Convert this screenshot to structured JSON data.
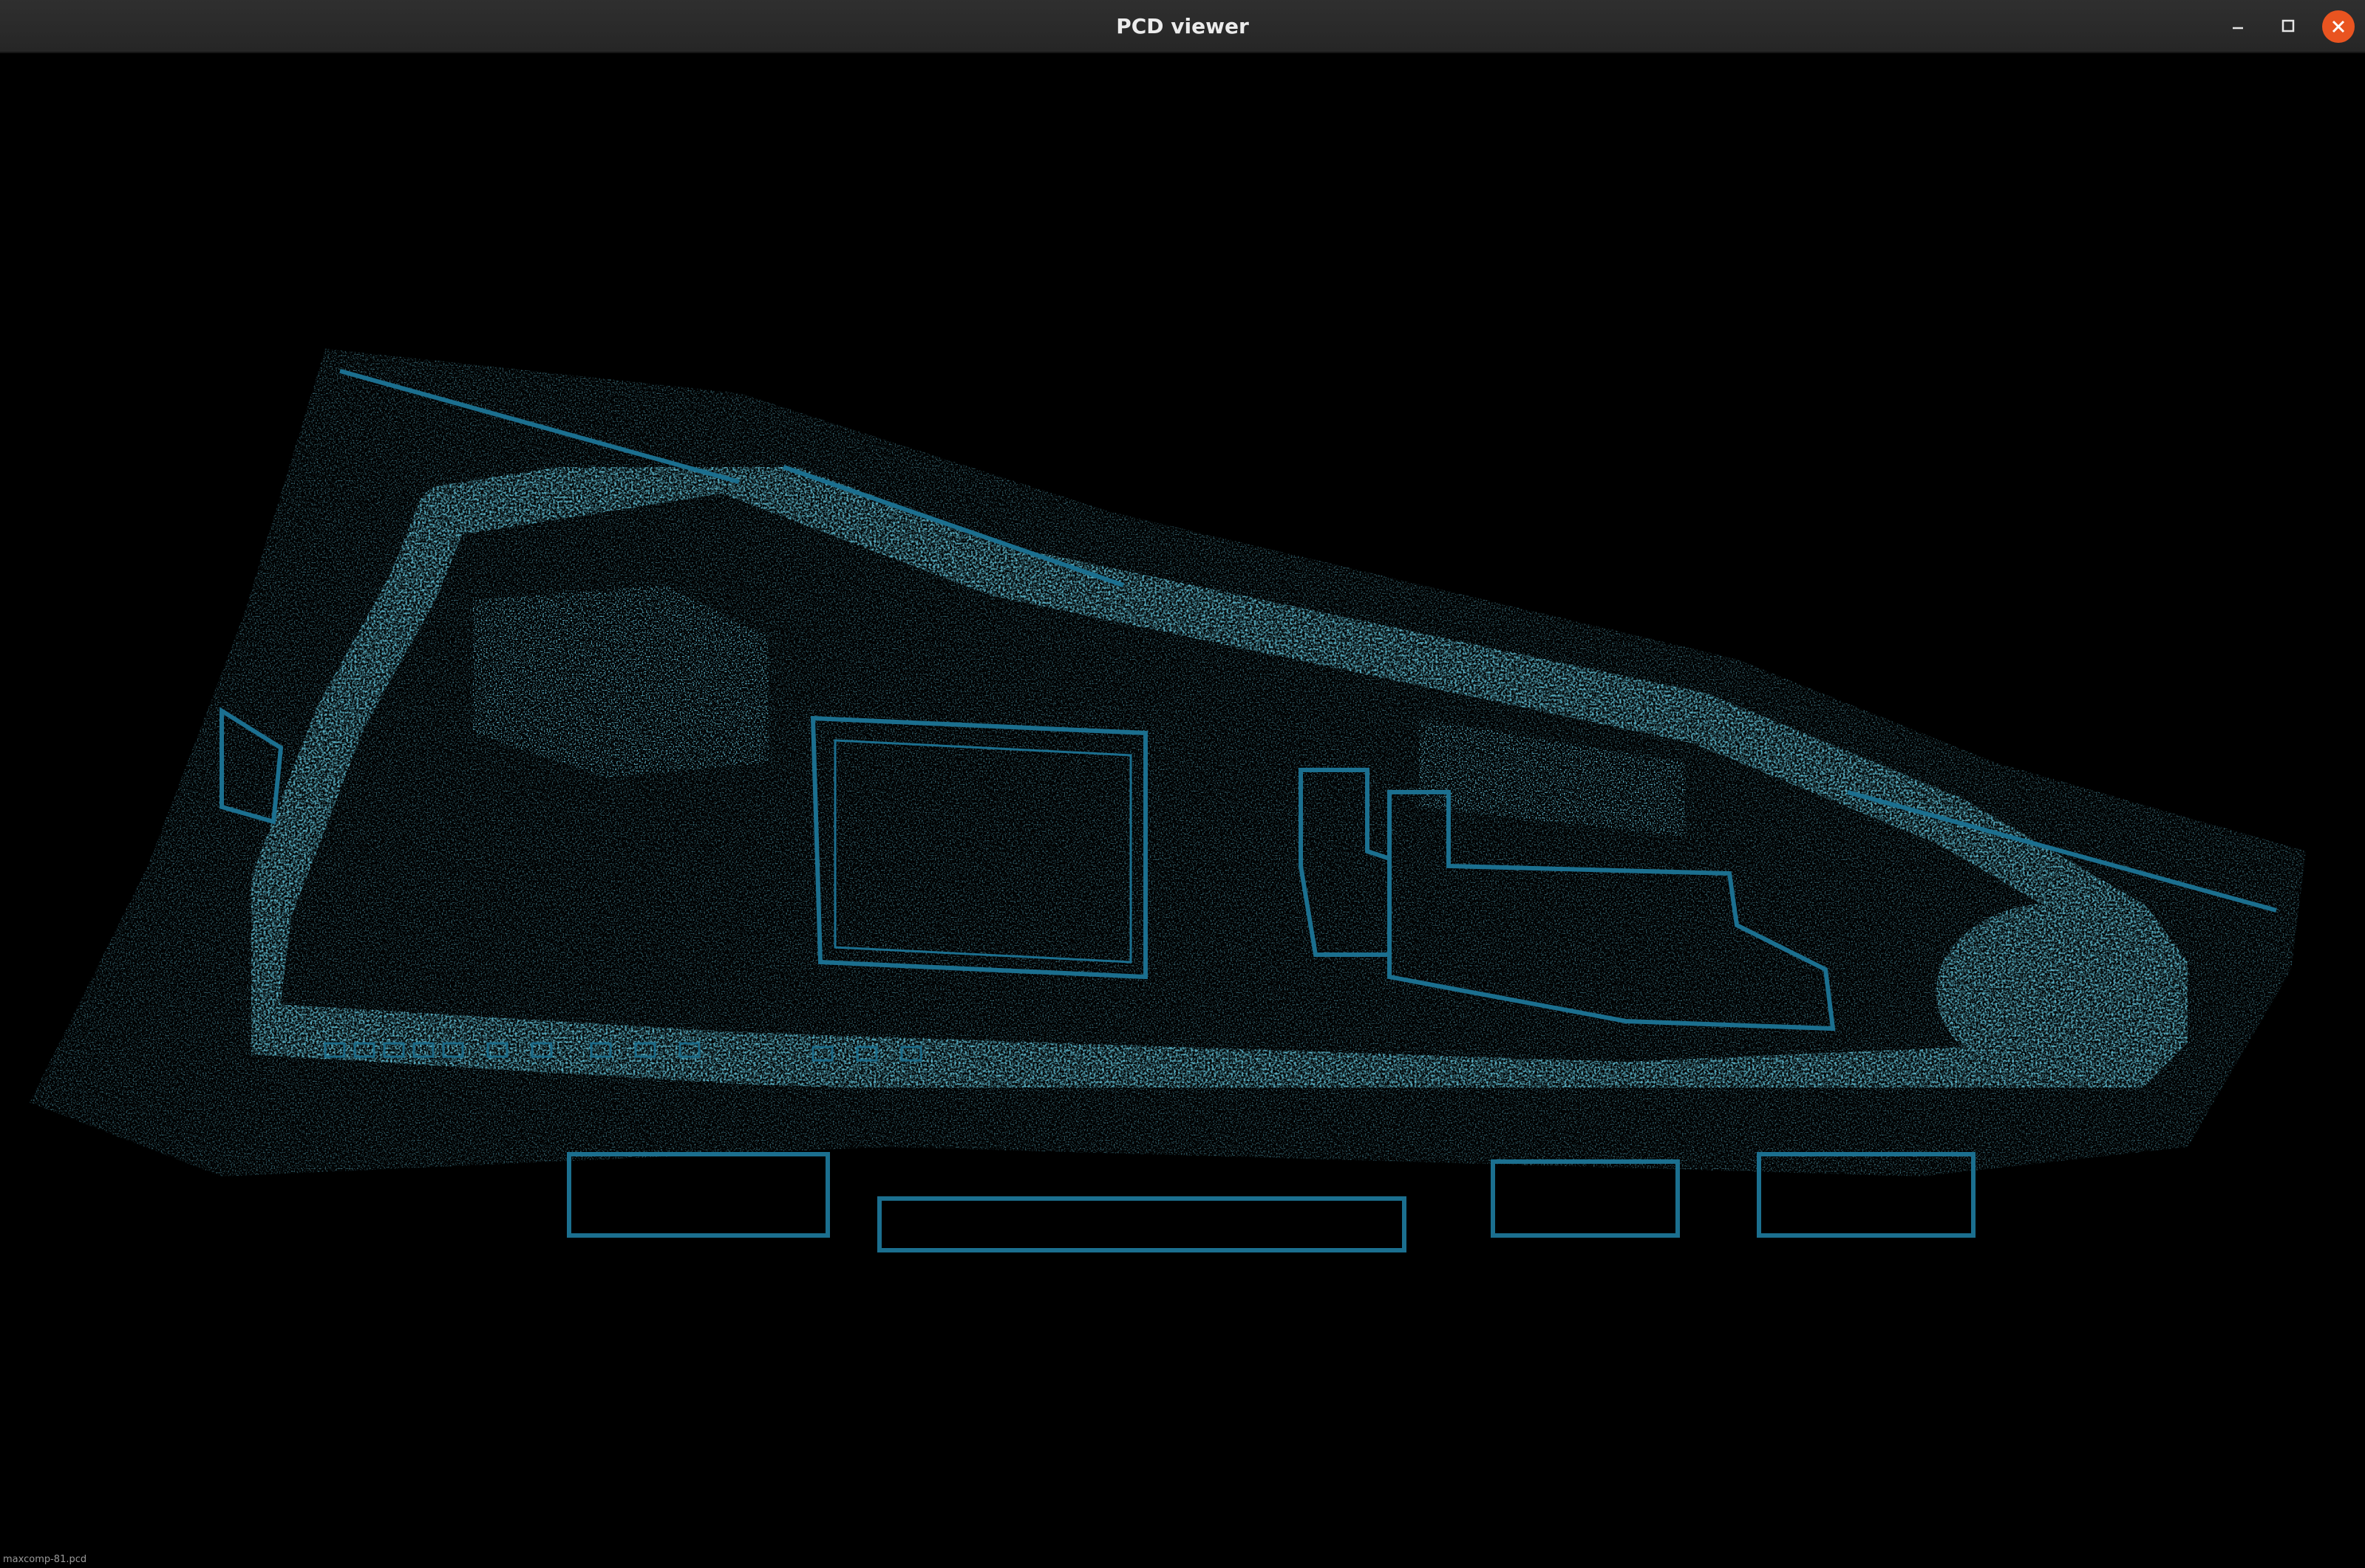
{
  "window": {
    "title": "PCD viewer",
    "buttons": {
      "minimize_icon": "minimize-icon",
      "maximize_icon": "maximize-icon",
      "close_icon": "close-icon"
    }
  },
  "viewer": {
    "background_color": "#000000",
    "point_color": "#1a6f8e",
    "status_filename": "maxcomp-81.pcd"
  },
  "colors": {
    "titlebar": "#2b2b2b",
    "close_button": "#e95420"
  }
}
